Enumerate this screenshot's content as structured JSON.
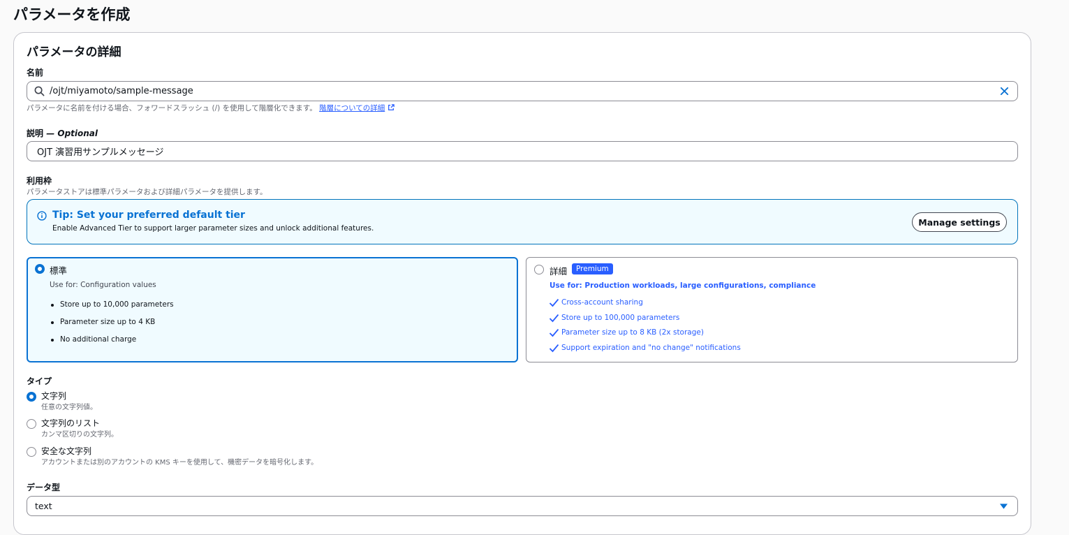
{
  "page": {
    "title": "パラメータを作成"
  },
  "details": {
    "section_title": "パラメータの詳細",
    "name": {
      "label": "名前",
      "value": "/ojt/miyamoto/sample-message",
      "hint": "パラメータに名前を付ける場合、フォワードスラッシュ (/) を使用して階層化できます。",
      "hint_link": "階層についての詳細"
    },
    "description": {
      "label": "説明",
      "label_optional": "— Optional",
      "value": "OJT 演習用サンプルメッセージ"
    },
    "tier": {
      "label": "利用枠",
      "hint": "パラメータストアは標準パラメータおよび詳細パラメータを提供します。",
      "tip": {
        "title": "Tip: Set your preferred default tier",
        "text": "Enable Advanced Tier to support larger parameter sizes and unlock additional features.",
        "button": "Manage settings"
      },
      "standard": {
        "title": "標準",
        "use_for": "Use for: Configuration values",
        "items": [
          "Store up to 10,000 parameters",
          "Parameter size up to 4 KB",
          "No additional charge"
        ],
        "selected": true
      },
      "advanced": {
        "title": "詳細",
        "badge": "Premium",
        "use_for": "Use for: Production workloads, large configurations, compliance",
        "items": [
          "Cross-account sharing",
          "Store up to 100,000 parameters",
          "Parameter size up to 8 KB (2x storage)",
          "Support expiration and \"no change\" notifications"
        ],
        "selected": false
      }
    },
    "type": {
      "label": "タイプ",
      "options": [
        {
          "label": "文字列",
          "desc": "任意の文字列値。",
          "checked": true
        },
        {
          "label": "文字列のリスト",
          "desc": "カンマ区切りの文字列。",
          "checked": false
        },
        {
          "label": "安全な文字列",
          "desc": "アカウントまたは別のアカウントの KMS キーを使用して、機密データを暗号化します。",
          "checked": false
        }
      ]
    },
    "data_type": {
      "label": "データ型",
      "value": "text"
    }
  },
  "colors": {
    "accent": "#0972d3",
    "link": "#295eff",
    "badge": "#295eff"
  },
  "icons": [
    "search-icon",
    "clear-icon",
    "external-link-icon",
    "info-icon",
    "check-icon",
    "caret-down-icon"
  ]
}
